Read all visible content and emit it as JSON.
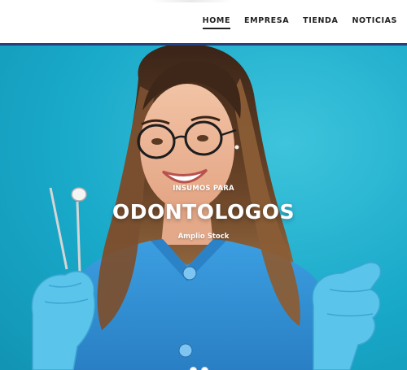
{
  "nav": {
    "items": [
      {
        "label": "HOME",
        "active": true
      },
      {
        "label": "EMPRESA",
        "active": false
      },
      {
        "label": "TIENDA",
        "active": false
      },
      {
        "label": "NOTICIAS",
        "active": false
      }
    ]
  },
  "hero": {
    "eyebrow": "INSUMOS PARA",
    "title": "ODONTOLOGOS",
    "subtitle": "Amplio Stock",
    "image": "smiling-dentist-photo"
  },
  "colors": {
    "header_border": "#23417e",
    "hero_background": "#19a9c9",
    "scrubs": "#2f8fd2",
    "gloves": "#5bc4ea"
  }
}
